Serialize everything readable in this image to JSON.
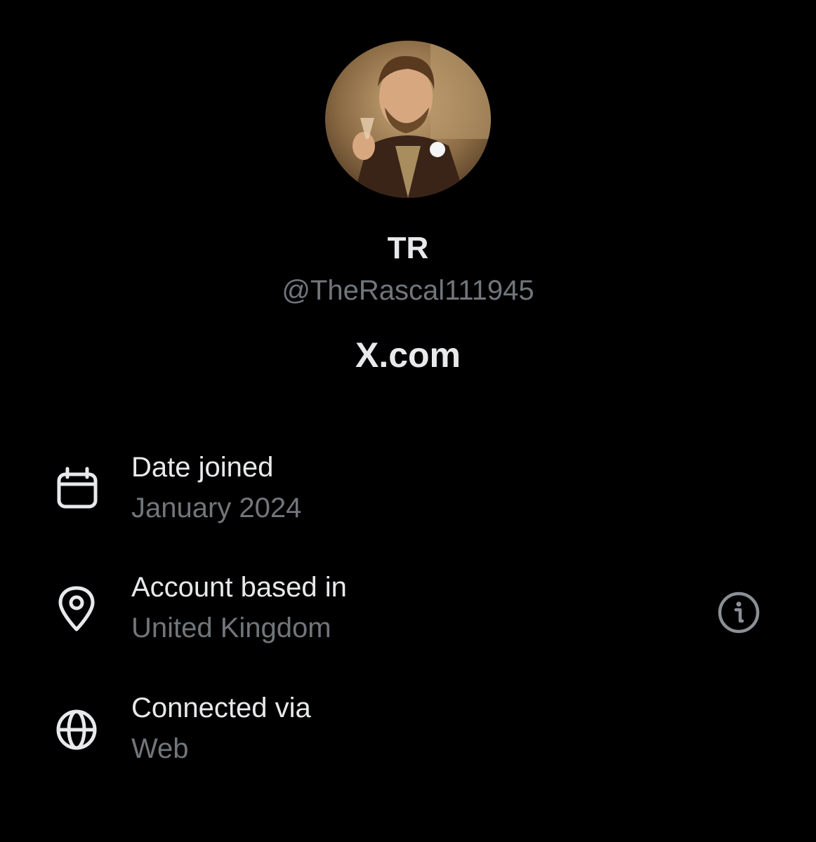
{
  "profile": {
    "display_name": "TR",
    "handle": "@TheRascal111945",
    "site": "X.com",
    "avatar_description": "profile-photo"
  },
  "details": [
    {
      "icon": "calendar-icon",
      "label": "Date joined",
      "value": "January 2024"
    },
    {
      "icon": "location-pin-icon",
      "label": "Account based in",
      "value": "United Kingdom",
      "has_info": true
    },
    {
      "icon": "globe-icon",
      "label": "Connected via",
      "value": "Web"
    }
  ],
  "colors": {
    "background": "#000000",
    "primary_text": "#e7e9ea",
    "secondary_text": "#71767b"
  }
}
